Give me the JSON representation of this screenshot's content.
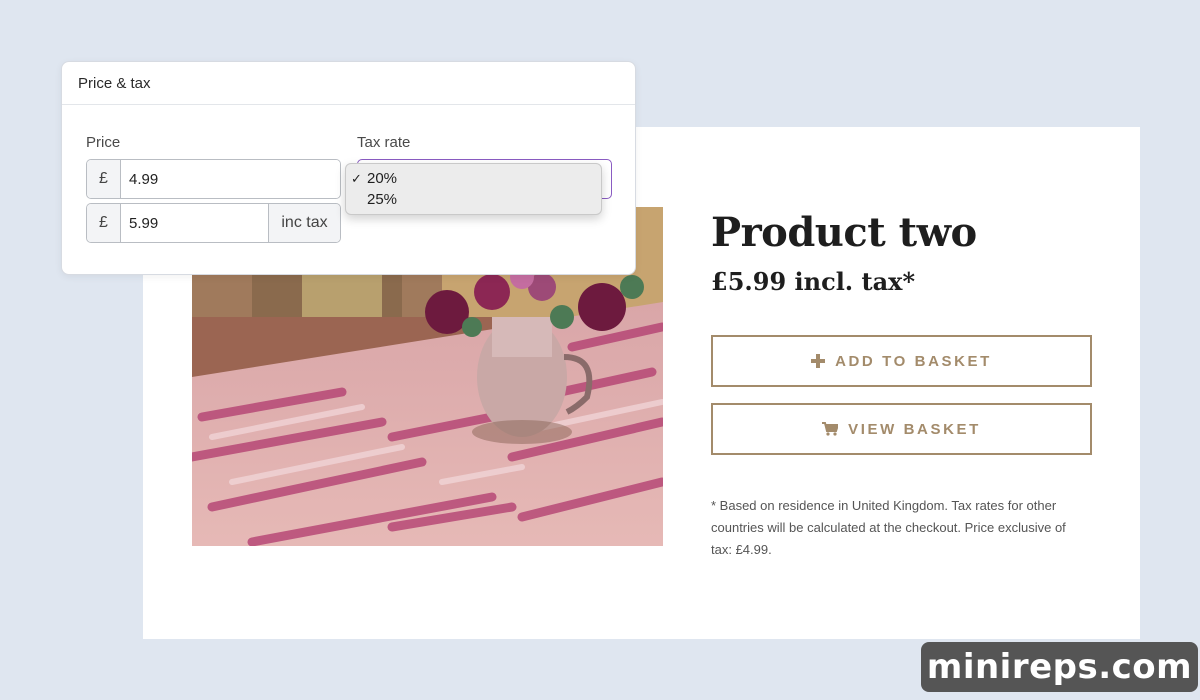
{
  "product": {
    "title": "Product two",
    "price_line": "£5.99 incl. tax*",
    "add_to_basket": "ADD TO BASKET",
    "view_basket": "VIEW BASKET",
    "footnote": "* Based on residence in United Kingdom. Tax rates for other countries will be calculated at the checkout. Price exclusive of tax: £4.99.",
    "accent_color": "#a38b6b",
    "add_icon": "plus-icon",
    "view_icon": "cart-icon"
  },
  "tax_panel": {
    "title": "Price & tax",
    "price_label": "Price",
    "tax_label": "Tax rate",
    "currency_symbol": "£",
    "price_ex_tax": "4.99",
    "price_inc_tax": "5.99",
    "inc_tax_suffix": "inc tax",
    "tax_options": [
      "20%",
      "25%"
    ],
    "selected_tax": "20%",
    "select_border_color": "#8a5cc2"
  },
  "watermark": {
    "text": "minireps.com"
  }
}
